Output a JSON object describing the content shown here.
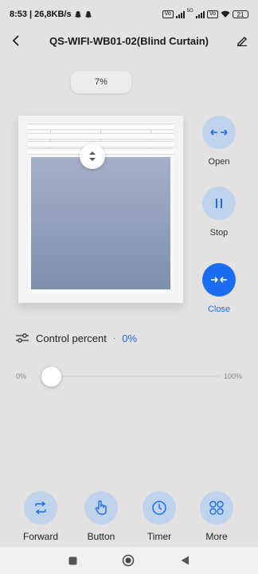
{
  "status_bar": {
    "time": "8:53",
    "net_speed": "26,8KB/s",
    "battery": "21",
    "volte1": "Vo",
    "volte2": "Vo",
    "net_type": "5G"
  },
  "header": {
    "title": "QS-WIFI-WB01-02(Blind Curtain)"
  },
  "position": {
    "percent_label": "7%",
    "level_percent": 7
  },
  "controls": {
    "open_label": "Open",
    "stop_label": "Stop",
    "close_label": "Close",
    "active": "close",
    "accent_color": "#1a6cf0",
    "inactive_color": "#bfd3ec"
  },
  "control_percent": {
    "label": "Control percent",
    "separator": "·",
    "value": "0%"
  },
  "slider": {
    "min_label": "0%",
    "max_label": "100%",
    "value": 0
  },
  "bottom_nav": [
    {
      "label": "Forward",
      "icon": "forward-icon"
    },
    {
      "label": "Button",
      "icon": "hand-tap-icon"
    },
    {
      "label": "Timer",
      "icon": "clock-icon"
    },
    {
      "label": "More",
      "icon": "grid-icon"
    }
  ],
  "system_nav": [
    "recent-apps-icon",
    "home-icon",
    "back-icon"
  ]
}
